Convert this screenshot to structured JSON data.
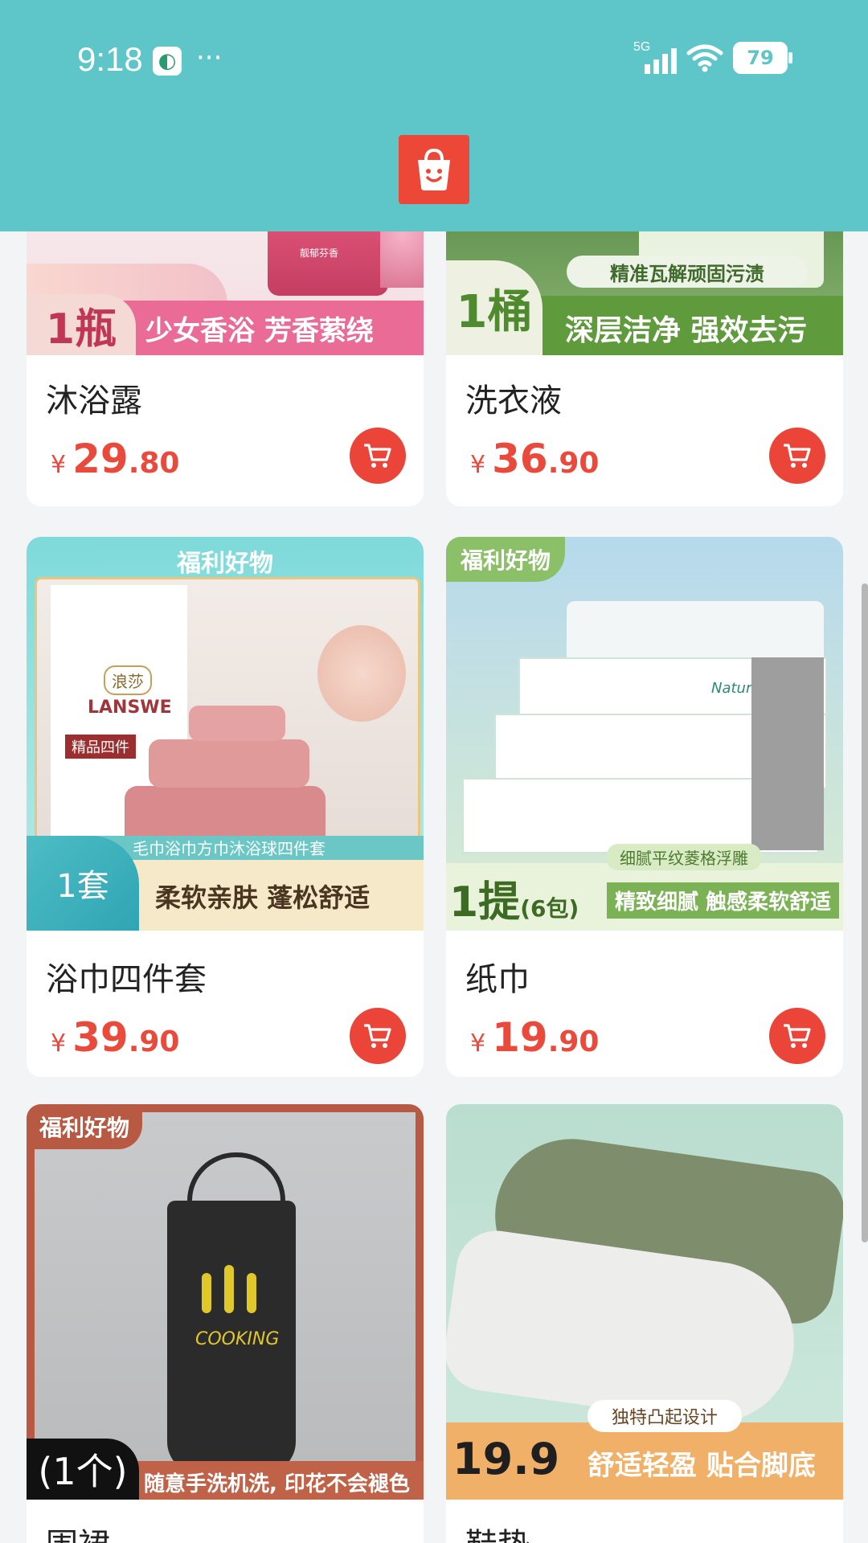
{
  "status": {
    "time": "9:18",
    "more": "···",
    "network": "5G",
    "battery": "79"
  },
  "colors": {
    "header": "#5ec5c8",
    "accent": "#ea4538",
    "price": "#e94a3c"
  },
  "products": [
    {
      "name": "沐浴露",
      "currency": "¥",
      "price_int": "29",
      "price_dec": ".80",
      "banner_qty": "1瓶",
      "banner_text": "少女香浴 芳香萦绕",
      "pack_label": "靓郁芬香"
    },
    {
      "name": "洗衣液",
      "currency": "¥",
      "price_int": "36",
      "price_dec": ".90",
      "banner_qty": "1桶",
      "banner_sub": "精准瓦解顽固污渍",
      "banner_text": "深层洁净 强效去污"
    },
    {
      "name": "浴巾四件套",
      "currency": "¥",
      "price_int": "39",
      "price_dec": ".90",
      "badge": "福利好物",
      "brand_cn": "浪莎",
      "brand": "LANSWE",
      "box_label": "精品四件",
      "banner_qty": "1套",
      "banner_sub": "毛巾浴巾方巾沐浴球四件套",
      "banner_text": "柔软亲肤 蓬松舒适"
    },
    {
      "name": "纸巾",
      "currency": "¥",
      "price_int": "19",
      "price_dec": ".90",
      "badge": "福利好物",
      "pack_label": "Natural",
      "banner_qty": "1提",
      "banner_qty_sub": "(6包)",
      "banner_sub": "细腻平纹菱格浮雕",
      "banner_text": "精致细腻 触感柔软舒适"
    },
    {
      "name": "围裙",
      "badge": "福利好物",
      "apron_text": "COOKING",
      "banner_qty": "(1个)",
      "banner_text": "随意手洗机洗, 印花不会褪色"
    },
    {
      "name": "鞋垫",
      "banner_price": "19.9",
      "banner_sub": "独特凸起设计",
      "banner_text": "舒适轻盈 贴合脚底"
    }
  ]
}
